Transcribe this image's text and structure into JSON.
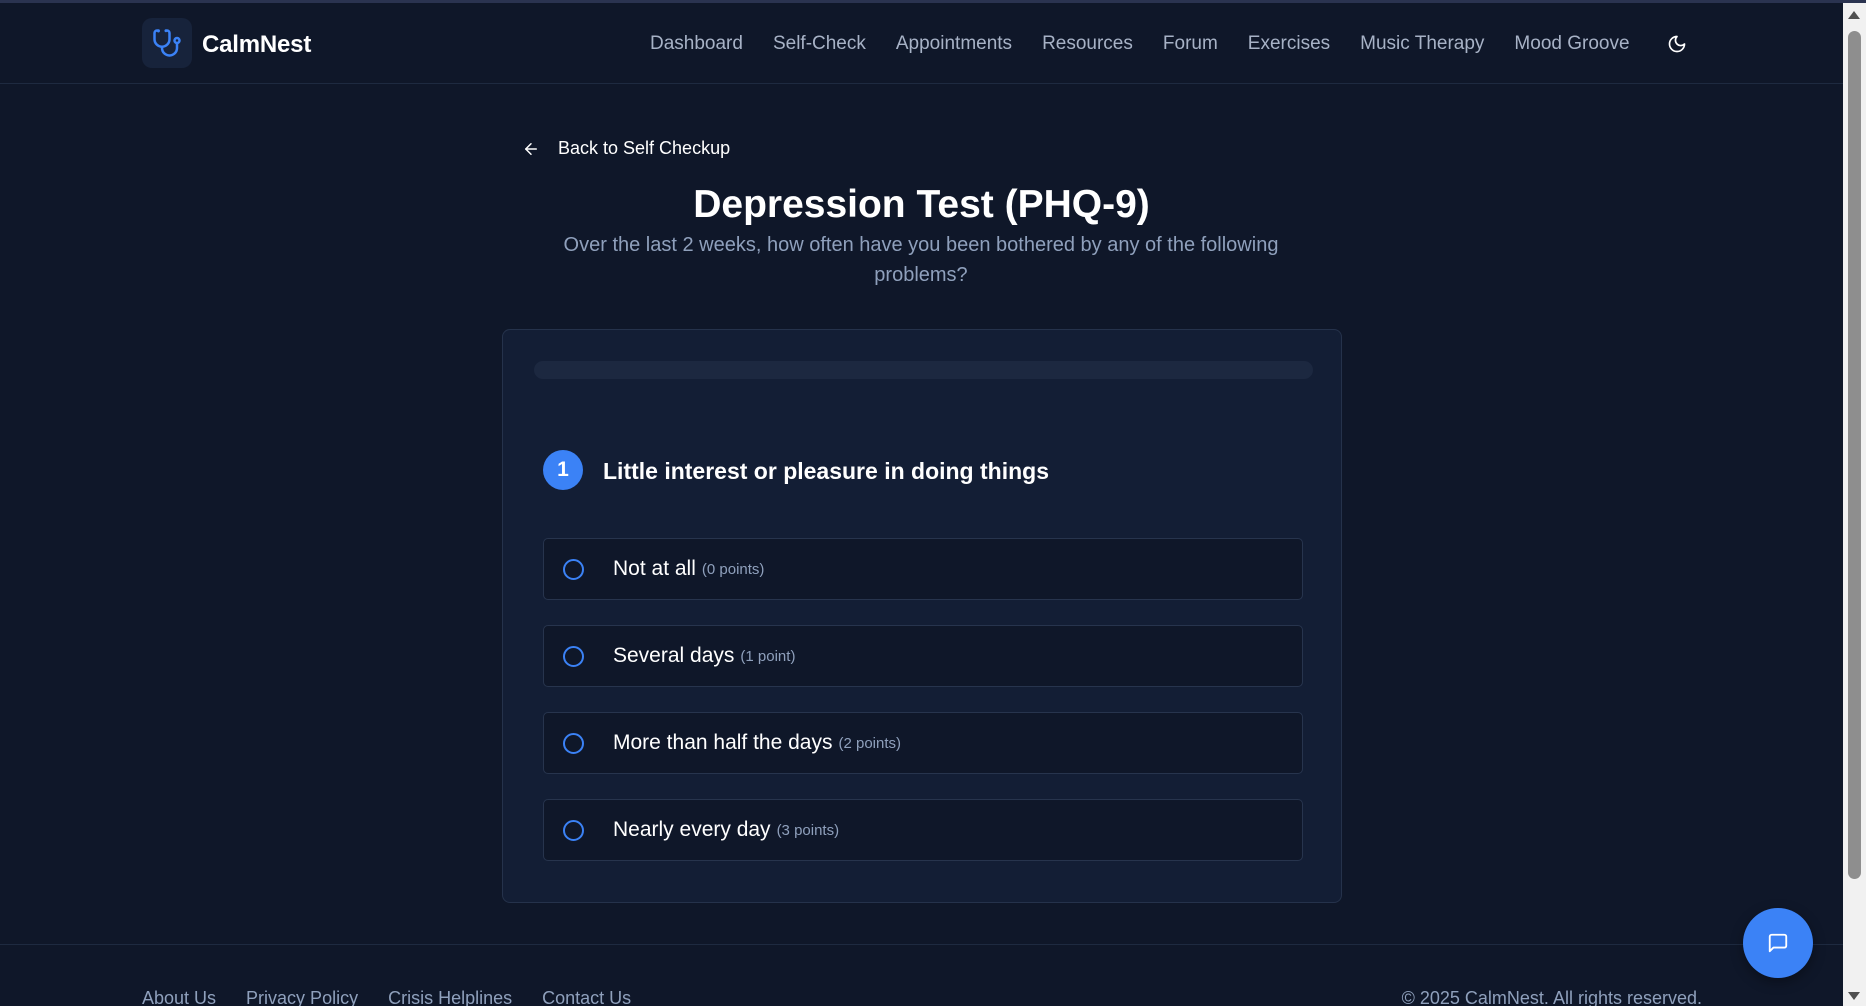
{
  "header": {
    "brand": "CalmNest",
    "logo_icon": "stethoscope-icon",
    "nav": [
      {
        "label": "Dashboard"
      },
      {
        "label": "Self-Check"
      },
      {
        "label": "Appointments"
      },
      {
        "label": "Resources"
      },
      {
        "label": "Forum"
      },
      {
        "label": "Exercises"
      },
      {
        "label": "Music Therapy"
      },
      {
        "label": "Mood Groove"
      }
    ],
    "theme_icon": "moon-icon"
  },
  "main": {
    "back_label": "Back to Self Checkup",
    "title": "Depression Test (PHQ-9)",
    "subtitle": "Over the last 2 weeks, how often have you been bothered by any of the following problems?",
    "progress": 0,
    "question": {
      "number": "1",
      "text": "Little interest or pleasure in doing things",
      "options": [
        {
          "label": "Not at all",
          "points": "(0 points)"
        },
        {
          "label": "Several days",
          "points": "(1 point)"
        },
        {
          "label": "More than half the days",
          "points": "(2 points)"
        },
        {
          "label": "Nearly every day",
          "points": "(3 points)"
        }
      ]
    }
  },
  "footer": {
    "links": [
      {
        "label": "About Us"
      },
      {
        "label": "Privacy Policy"
      },
      {
        "label": "Crisis Helplines"
      },
      {
        "label": "Contact Us"
      }
    ],
    "copyright": "© 2025 CalmNest. All rights reserved."
  },
  "colors": {
    "background": "#0f1729",
    "card": "#131e35",
    "accent": "#3b82f6",
    "muted_text": "#8fa0bc"
  }
}
